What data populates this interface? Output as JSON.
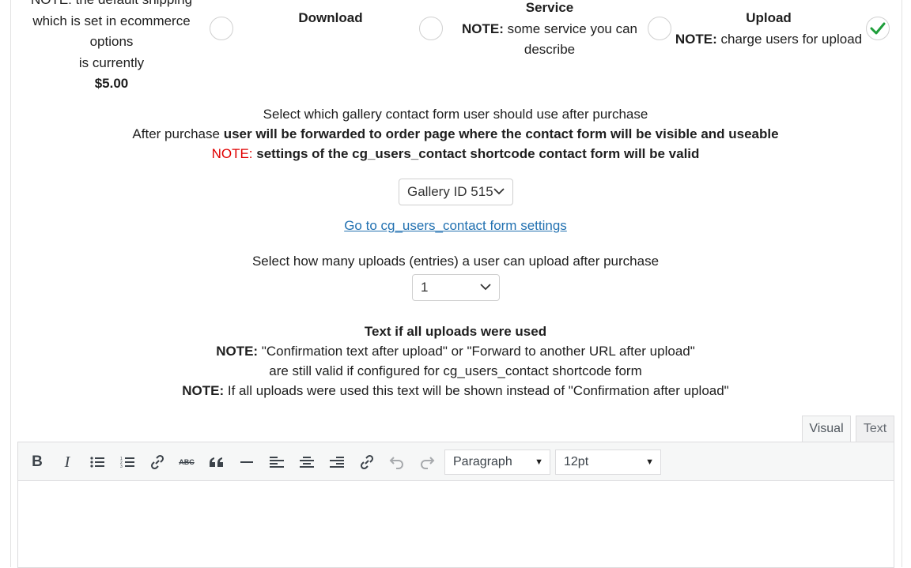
{
  "options": {
    "shipping": {
      "line1": "NOTE: the default shipping",
      "line2": "which is set in ecommerce",
      "line3": "options",
      "line4": "is currently",
      "price": "$5.00"
    },
    "download": {
      "title": "Download"
    },
    "service": {
      "title": "Service",
      "note_label": "NOTE:",
      "note_text": " some service you can",
      "note_text2": "describe"
    },
    "upload": {
      "title": "Upload",
      "note_label": "NOTE:",
      "note_text": " charge users for upload"
    }
  },
  "contact_section": {
    "line1": "Select which gallery contact form user should use after purchase",
    "line2_prefix": "After purchase ",
    "line2_bold": "user will be forwarded to order page where the contact form will be visible and useable",
    "line3_note": "NOTE:",
    "line3_bold": " settings of the cg_users_contact shortcode contact form will be valid",
    "gallery_select": "Gallery ID 515",
    "settings_link": "Go to cg_users_contact form settings"
  },
  "uploads_section": {
    "label": "Select how many uploads (entries) a user can upload after purchase",
    "count_select": "1"
  },
  "text_section": {
    "title": "Text if all uploads were used",
    "note1_label": "NOTE:",
    "note1_text": " \"Confirmation text after upload\" or \"Forward to another URL after upload\"",
    "note1_line2": "are still valid if configured for cg_users_contact shortcode form",
    "note2_label": "NOTE:",
    "note2_text": " If all uploads were used this text will be shown instead of \"Confirmation after upload\""
  },
  "editor": {
    "tab_visual": "Visual",
    "tab_text": "Text",
    "format_select": "Paragraph",
    "size_select": "12pt",
    "bold_label": "B",
    "italic_label": "I",
    "strike_label": "ABC"
  },
  "colors": {
    "accent_check": "#1e9e3a",
    "note_red": "#e00000",
    "link_blue": "#2271b1"
  }
}
